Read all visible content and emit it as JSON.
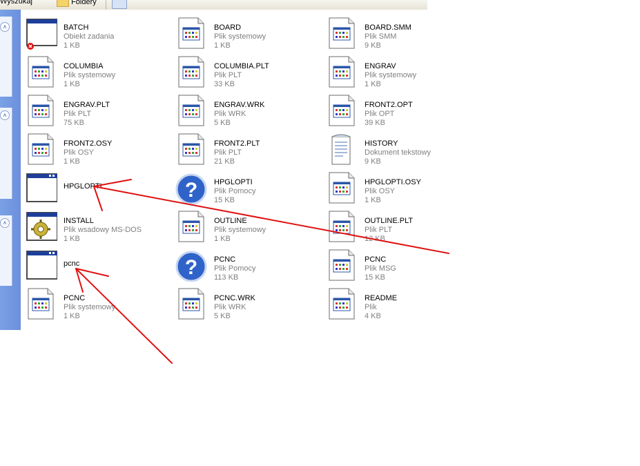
{
  "toolbar": {
    "back_label": "Wyszukaj",
    "folders_label": "Foldery"
  },
  "taskpane": {
    "collapse_glyph": "˄"
  },
  "files": [
    {
      "name": "BATCH",
      "type": "Obiekt zadania",
      "size": "1 KB",
      "icon": "scheduled-task-icon"
    },
    {
      "name": "BOARD",
      "type": "Plik systemowy",
      "size": "1 KB",
      "icon": "system-file-icon"
    },
    {
      "name": "BOARD.SMM",
      "type": "Plik SMM",
      "size": "9 KB",
      "icon": "system-file-icon"
    },
    {
      "name": "COLUMBIA",
      "type": "Plik systemowy",
      "size": "1 KB",
      "icon": "system-file-icon"
    },
    {
      "name": "COLUMBIA.PLT",
      "type": "Plik PLT",
      "size": "33 KB",
      "icon": "system-file-icon"
    },
    {
      "name": "ENGRAV",
      "type": "Plik systemowy",
      "size": "1 KB",
      "icon": "system-file-icon"
    },
    {
      "name": "ENGRAV.PLT",
      "type": "Plik PLT",
      "size": "75 KB",
      "icon": "system-file-icon"
    },
    {
      "name": "ENGRAV.WRK",
      "type": "Plik WRK",
      "size": "5 KB",
      "icon": "system-file-icon"
    },
    {
      "name": "FRONT2.OPT",
      "type": "Plik OPT",
      "size": "39 KB",
      "icon": "system-file-icon"
    },
    {
      "name": "FRONT2.OSY",
      "type": "Plik OSY",
      "size": "1 KB",
      "icon": "system-file-icon"
    },
    {
      "name": "FRONT2.PLT",
      "type": "Plik PLT",
      "size": "21 KB",
      "icon": "system-file-icon"
    },
    {
      "name": "HISTORY",
      "type": "Dokument tekstowy",
      "size": "9 KB",
      "icon": "text-document-icon"
    },
    {
      "name": "HPGLOPTI",
      "type": "",
      "size": "",
      "icon": "application-window-icon"
    },
    {
      "name": "HPGLOPTI",
      "type": "Plik Pomocy",
      "size": "15 KB",
      "icon": "help-file-icon"
    },
    {
      "name": "HPGLOPTI.OSY",
      "type": "Plik OSY",
      "size": "1 KB",
      "icon": "system-file-icon"
    },
    {
      "name": "INSTALL",
      "type": "Plik wsadowy MS-DOS",
      "size": "1 KB",
      "icon": "batch-file-icon"
    },
    {
      "name": "OUTLINE",
      "type": "Plik systemowy",
      "size": "1 KB",
      "icon": "system-file-icon"
    },
    {
      "name": "OUTLINE.PLT",
      "type": "Plik PLT",
      "size": "12 KB",
      "icon": "system-file-icon"
    },
    {
      "name": "pcnc",
      "type": "",
      "size": "",
      "icon": "application-window-icon"
    },
    {
      "name": "PCNC",
      "type": "Plik Pomocy",
      "size": "113 KB",
      "icon": "help-file-icon"
    },
    {
      "name": "PCNC",
      "type": "Plik MSG",
      "size": "15 KB",
      "icon": "system-file-icon"
    },
    {
      "name": "PCNC",
      "type": "Plik systemowy",
      "size": "1 KB",
      "icon": "system-file-icon"
    },
    {
      "name": "PCNC.WRK",
      "type": "Plik WRK",
      "size": "5 KB",
      "icon": "system-file-icon"
    },
    {
      "name": "README",
      "type": "Plik",
      "size": "4 KB",
      "icon": "system-file-icon"
    }
  ],
  "colors": {
    "annotation": "#e01010",
    "taskpane": "#7aa1e6"
  }
}
